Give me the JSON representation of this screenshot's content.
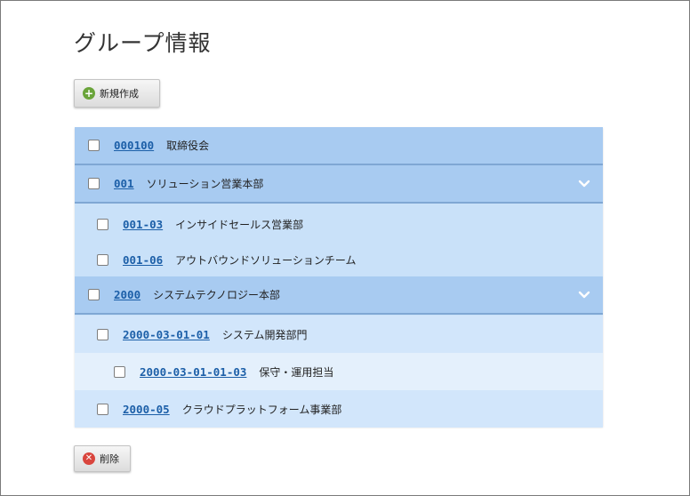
{
  "page": {
    "title": "グループ情報"
  },
  "toolbar": {
    "new_label": "新規作成",
    "delete_label": "削除"
  },
  "groups": [
    {
      "code": "000100",
      "name": "取締役会"
    },
    {
      "code": "001",
      "name": "ソリューション営業本部"
    },
    {
      "code": "001-03",
      "name": "インサイドセールス営業部"
    },
    {
      "code": "001-06",
      "name": "アウトバウンドソリューションチーム"
    },
    {
      "code": "2000",
      "name": "システムテクノロジー本部"
    },
    {
      "code": "2000-03-01-01",
      "name": "システム開発部門"
    },
    {
      "code": "2000-03-01-01-03",
      "name": "保守・運用担当"
    },
    {
      "code": "2000-05",
      "name": "クラウドプラットフォーム事業部"
    }
  ],
  "icons": {
    "add": "plus-circle-icon",
    "delete": "x-circle-icon",
    "expand": "chevron-down-icon"
  },
  "colors": {
    "link": "#1c5fa8",
    "level0_bg": "#a8cbf1",
    "level1_bg": "#c9e1f9",
    "level2_bg": "#e4f0fc",
    "add_icon": "#6aa43a",
    "delete_icon": "#d9453d"
  }
}
